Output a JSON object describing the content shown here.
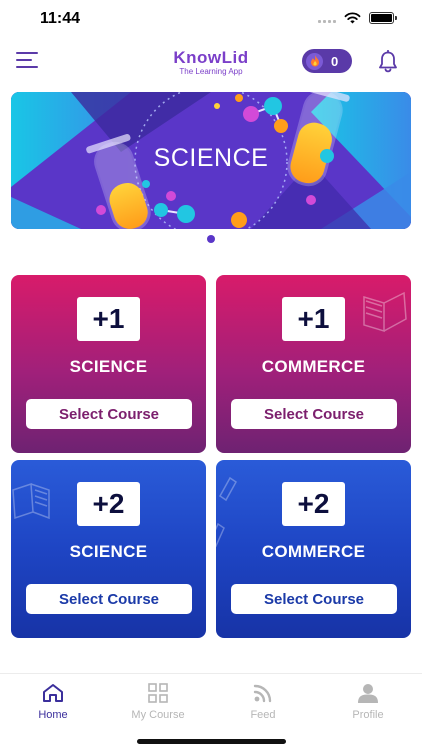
{
  "status_bar": {
    "time": "11:44"
  },
  "header": {
    "logo_name": "KnowLid",
    "logo_tagline": "The Learning App",
    "coin_count": "0"
  },
  "banner": {
    "title": "SCIENCE",
    "slide_index": 1,
    "slide_count": 1
  },
  "courses": [
    {
      "grade": "+1",
      "stream": "SCIENCE",
      "button": "Select Course"
    },
    {
      "grade": "+1",
      "stream": "COMMERCE",
      "button": "Select Course"
    },
    {
      "grade": "+2",
      "stream": "SCIENCE",
      "button": "Select Course"
    },
    {
      "grade": "+2",
      "stream": "COMMERCE",
      "button": "Select Course"
    }
  ],
  "nav": {
    "items": [
      {
        "label": "Home",
        "icon": "home-icon",
        "active": true
      },
      {
        "label": "My Course",
        "icon": "grid-icon",
        "active": false
      },
      {
        "label": "Feed",
        "icon": "feed-icon",
        "active": false
      },
      {
        "label": "Profile",
        "icon": "profile-icon",
        "active": false
      }
    ]
  },
  "colors": {
    "brand_purple": "#7b3fc9",
    "card_pink_top": "#d81b6a",
    "card_pink_bottom": "#6e2272",
    "card_blue_top": "#2a5bd8",
    "card_blue_bottom": "#1733a6",
    "nav_active": "#3b2f9c"
  }
}
